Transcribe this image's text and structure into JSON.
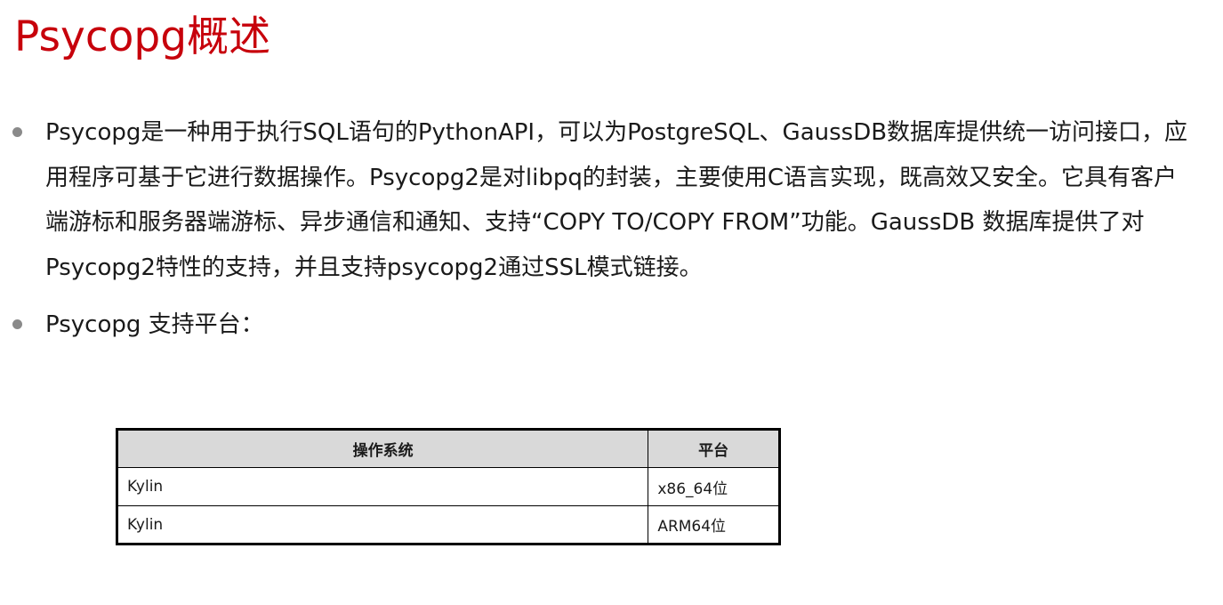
{
  "slide": {
    "title": "Psycopg概述",
    "bullets": [
      "Psycopg是一种用于执行SQL语句的PythonAPI，可以为PostgreSQL、GaussDB数据库提供统一访问接口，应用程序可基于它进行数据操作。Psycopg2是对libpq的封装，主要使用C语言实现，既高效又安全。它具有客户端游标和服务器端游标、异步通信和通知、支持“COPY TO/COPY FROM”功能。GaussDB 数据库提供了对Psycopg2特性的支持，并且支持psycopg2通过SSL模式链接。",
      "Psycopg 支持平台："
    ],
    "title_color": "#c7000b"
  },
  "table": {
    "headers": [
      "操作系统",
      "平台"
    ],
    "rows": [
      [
        "Kylin",
        "x86_64位"
      ],
      [
        "Kylin",
        "ARM64位"
      ]
    ]
  }
}
